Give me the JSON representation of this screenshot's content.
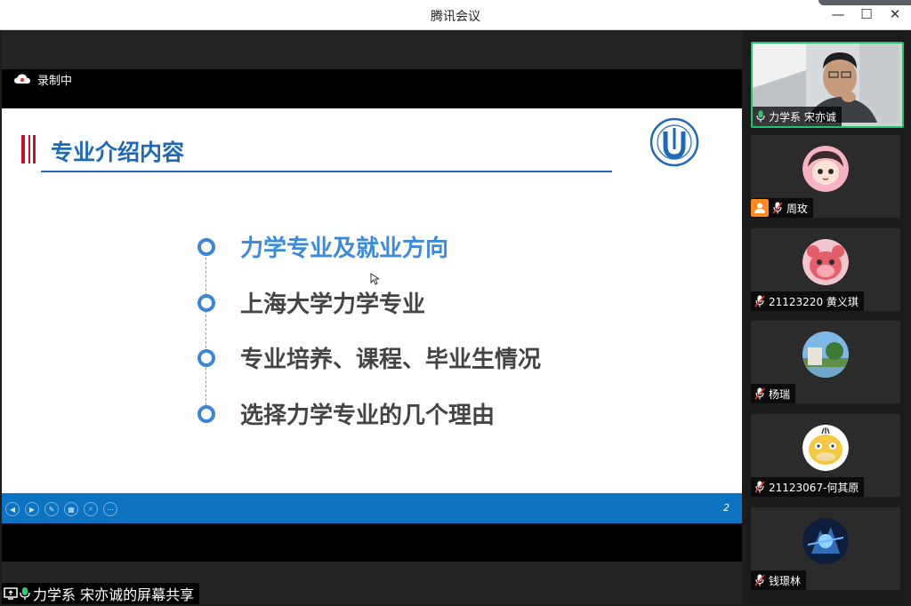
{
  "window": {
    "title": "腾讯会议",
    "minimize": "—",
    "maximize": "☐",
    "close": "✕"
  },
  "recording": {
    "label": "录制中"
  },
  "slide": {
    "title": "专业介绍内容",
    "page_number": "2",
    "bullets": [
      {
        "text": "力学专业及就业方向"
      },
      {
        "text": "上海大学力学专业"
      },
      {
        "text": "专业培养、课程、毕业生情况"
      },
      {
        "text": "选择力学专业的几个理由"
      }
    ]
  },
  "share_label": "力学系 宋亦诚的屏幕共享",
  "participants": [
    {
      "name": "力学系 宋亦诚",
      "mic": "on"
    },
    {
      "name": "周玫",
      "mic": "muted",
      "host": true
    },
    {
      "name": "21123220 黄义琪",
      "mic": "muted"
    },
    {
      "name": "杨瑞",
      "mic": "muted"
    },
    {
      "name": "21123067-何其原",
      "mic": "muted"
    },
    {
      "name": "钱璟林",
      "mic": "muted"
    }
  ],
  "colors": {
    "slide_blue": "#1f69b4",
    "footer_blue": "#0d72c0",
    "active_speaker": "#22c36b",
    "host_orange": "#ff8a1f"
  }
}
